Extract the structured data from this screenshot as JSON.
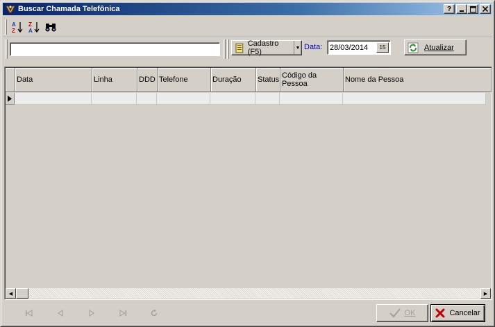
{
  "window": {
    "title": "Buscar Chamada Telefônica",
    "controls": {
      "help": "?",
      "minimize": "_",
      "maximize": "□",
      "close": "×"
    }
  },
  "toolbar": {
    "icons": [
      "sort-ascending-icon",
      "sort-descending-icon",
      "binoculars-icon"
    ]
  },
  "search": {
    "value": ""
  },
  "cadastro_button": {
    "label": "Cadastro (F5)"
  },
  "date": {
    "label": "Data:",
    "value": "28/03/2014",
    "calendar_label": "15"
  },
  "refresh_button": {
    "label": "Atualizar"
  },
  "grid": {
    "columns": [
      "Data",
      "Linha",
      "DDD",
      "Telefone",
      "Duração",
      "Status",
      "Código da Pessoa",
      "Nome da Pessoa"
    ],
    "rows": [
      [
        "",
        "",
        "",
        "",
        "",
        "",
        "",
        ""
      ]
    ]
  },
  "navigation": {
    "buttons": [
      "first-record-icon",
      "prior-record-icon",
      "next-record-icon",
      "last-record-icon",
      "refresh-record-icon"
    ]
  },
  "ok_button": {
    "label": "OK",
    "enabled": false
  },
  "cancel_button": {
    "label": "Cancelar"
  },
  "colors": {
    "title_start": "#0a246a",
    "title_end": "#a6caf0",
    "date_label": "#0000c0",
    "cancel_x": "#c00000",
    "refresh_icon": "#2e8b2e"
  }
}
